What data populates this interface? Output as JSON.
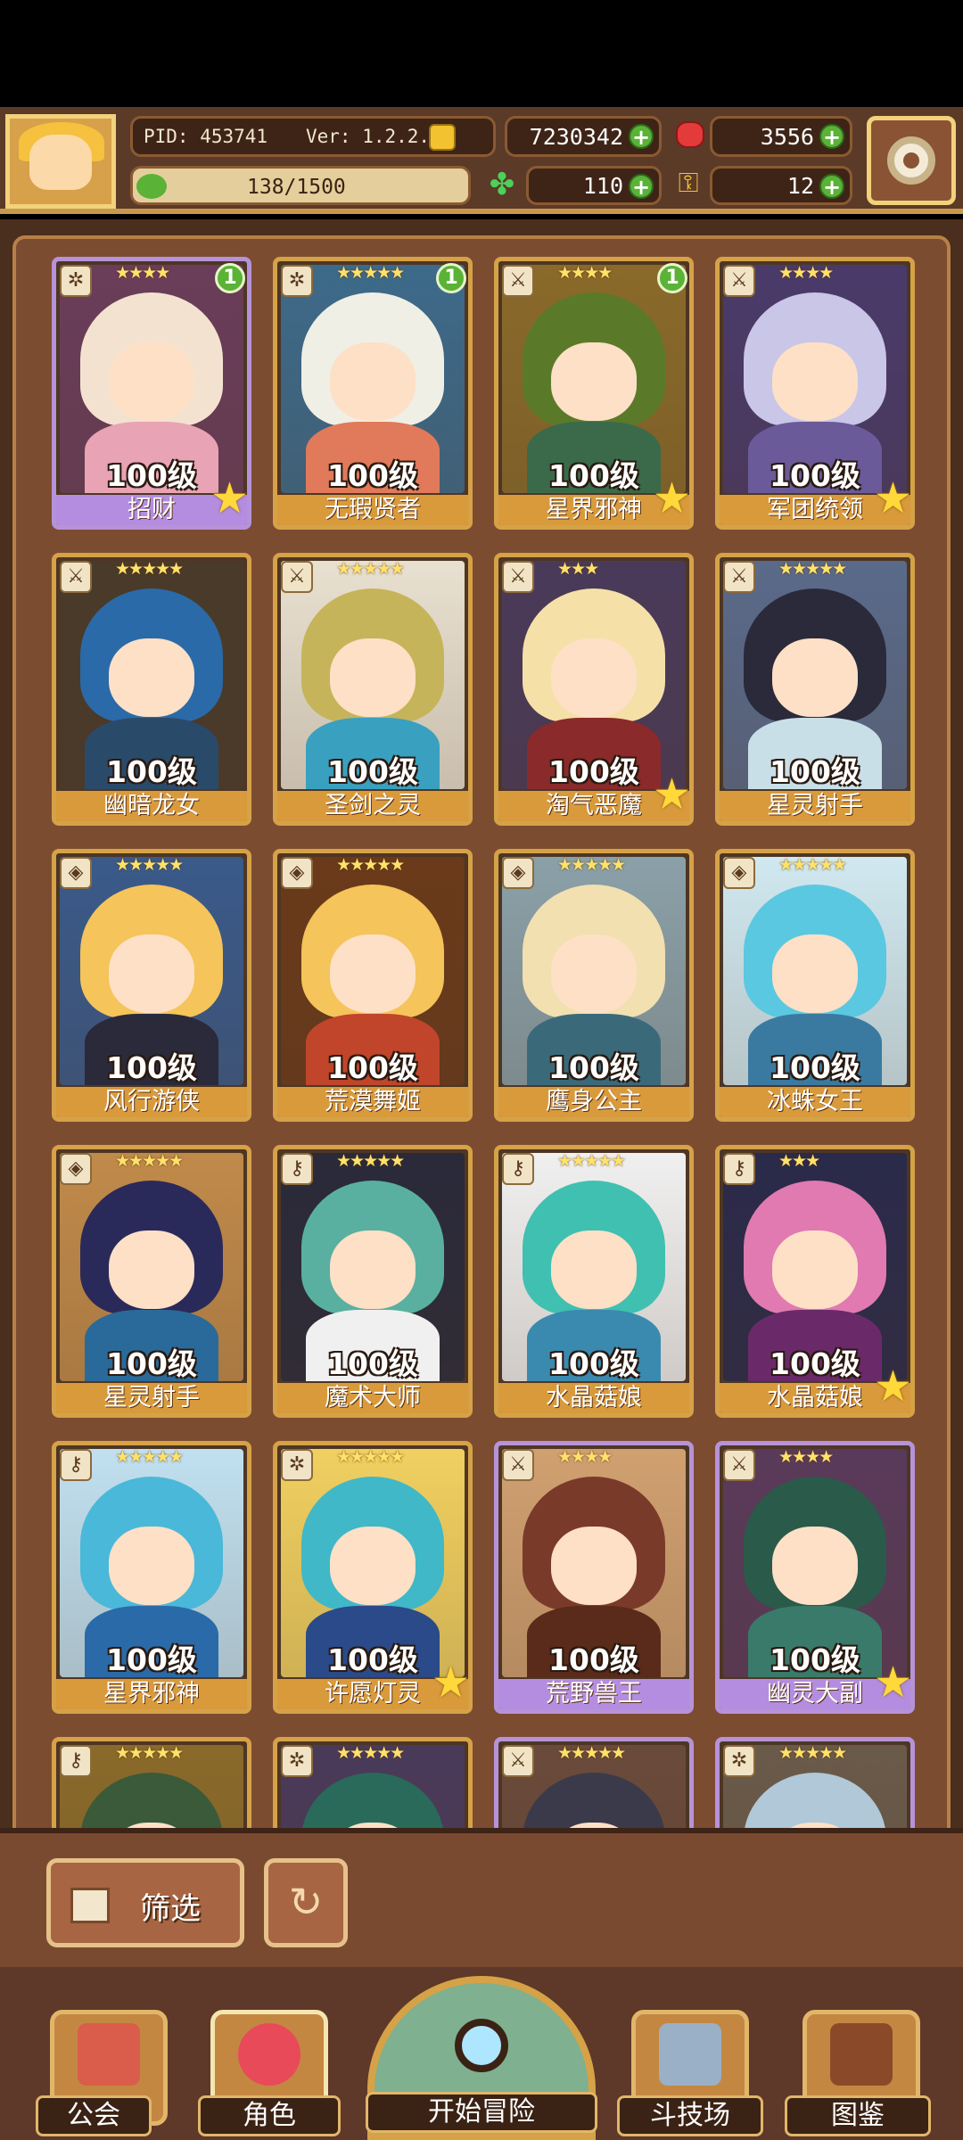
{
  "header": {
    "pid": "PID: 453741",
    "version": "Ver: 1.2.2.5",
    "gold": "7230342",
    "gems": "3556",
    "stamina": "138/1500",
    "clover": "110",
    "keys": "12"
  },
  "cards": [
    {
      "name": "招财",
      "level": "100级",
      "stars": "★★★★",
      "class_icon": "gear-icon",
      "frame": "purple",
      "badge": "1",
      "star_mark": true
    },
    {
      "name": "无瑕贤者",
      "level": "100级",
      "stars": "★★★★★",
      "class_icon": "gear-icon",
      "frame": "gold",
      "badge": "1",
      "star_mark": false
    },
    {
      "name": "星界邪神",
      "level": "100级",
      "stars": "★★★★",
      "class_icon": "sword-icon",
      "frame": "gold",
      "badge": "1",
      "star_mark": true
    },
    {
      "name": "军团统领",
      "level": "100级",
      "stars": "★★★★",
      "class_icon": "sword-icon",
      "frame": "gold",
      "badge": "",
      "star_mark": true
    },
    {
      "name": "幽暗龙女",
      "level": "100级",
      "stars": "★★★★★",
      "class_icon": "sword-icon",
      "frame": "gold",
      "badge": "",
      "star_mark": false
    },
    {
      "name": "圣剑之灵",
      "level": "100级",
      "stars": "★★★★★",
      "class_icon": "sword-icon",
      "frame": "gold",
      "badge": "",
      "star_mark": false
    },
    {
      "name": "淘气恶魔",
      "level": "100级",
      "stars": "★★★",
      "class_icon": "sword-icon",
      "frame": "gold",
      "badge": "",
      "star_mark": true
    },
    {
      "name": "星灵射手",
      "level": "100级",
      "stars": "★★★★★",
      "class_icon": "sword-icon",
      "frame": "gold",
      "badge": "",
      "star_mark": false
    },
    {
      "name": "风行游侠",
      "level": "100级",
      "stars": "★★★★★",
      "class_icon": "shield-icon",
      "frame": "gold",
      "badge": "",
      "star_mark": false
    },
    {
      "name": "荒漠舞姬",
      "level": "100级",
      "stars": "★★★★★",
      "class_icon": "shield-icon",
      "frame": "gold",
      "badge": "",
      "star_mark": false
    },
    {
      "name": "鹰身公主",
      "level": "100级",
      "stars": "★★★★★",
      "class_icon": "shield-icon",
      "frame": "gold",
      "badge": "",
      "star_mark": false
    },
    {
      "name": "冰蛛女王",
      "level": "100级",
      "stars": "★★★★★",
      "class_icon": "shield-icon",
      "frame": "gold",
      "badge": "",
      "star_mark": false
    },
    {
      "name": "星灵射手",
      "level": "100级",
      "stars": "★★★★★",
      "class_icon": "shield-icon",
      "frame": "gold",
      "badge": "",
      "star_mark": false
    },
    {
      "name": "魔术大师",
      "level": "100级",
      "stars": "★★★★★",
      "class_icon": "key-icon",
      "frame": "gold",
      "badge": "",
      "star_mark": false
    },
    {
      "name": "水晶菇娘",
      "level": "100级",
      "stars": "★★★★★",
      "class_icon": "key-icon",
      "frame": "gold",
      "badge": "",
      "star_mark": false
    },
    {
      "name": "水晶菇娘",
      "level": "100级",
      "stars": "★★★",
      "class_icon": "key-icon",
      "frame": "gold",
      "badge": "",
      "star_mark": true
    },
    {
      "name": "星界邪神",
      "level": "100级",
      "stars": "★★★★★",
      "class_icon": "key-icon",
      "frame": "gold",
      "badge": "",
      "star_mark": false
    },
    {
      "name": "许愿灯灵",
      "level": "100级",
      "stars": "★★★★★",
      "class_icon": "gear-icon",
      "frame": "gold",
      "badge": "",
      "star_mark": true
    },
    {
      "name": "荒野兽王",
      "level": "100级",
      "stars": "★★★★",
      "class_icon": "sword-icon",
      "frame": "purple",
      "badge": "",
      "star_mark": false
    },
    {
      "name": "幽灵大副",
      "level": "100级",
      "stars": "★★★★",
      "class_icon": "sword-icon",
      "frame": "purple",
      "badge": "",
      "star_mark": true
    },
    {
      "name": "",
      "level": "",
      "stars": "★★★★★",
      "class_icon": "key-icon",
      "frame": "gold",
      "badge": "",
      "star_mark": false
    },
    {
      "name": "",
      "level": "",
      "stars": "★★★★★",
      "class_icon": "gear-icon",
      "frame": "gold",
      "badge": "",
      "star_mark": false
    },
    {
      "name": "",
      "level": "",
      "stars": "★★★★★",
      "class_icon": "sword-icon",
      "frame": "purple",
      "badge": "",
      "star_mark": false
    },
    {
      "name": "",
      "level": "",
      "stars": "★★★★★",
      "class_icon": "gear-icon",
      "frame": "purple",
      "badge": "",
      "star_mark": false
    }
  ],
  "controls": {
    "filter_label": "筛选"
  },
  "nav": {
    "guild": "公会",
    "character": "角色",
    "adventure": "开始冒险",
    "arena": "斗技场",
    "codex": "图鉴"
  },
  "colors": {
    "gold_frame": "#d6a247",
    "purple_frame": "#b693d8",
    "panel": "#7c4c31"
  }
}
